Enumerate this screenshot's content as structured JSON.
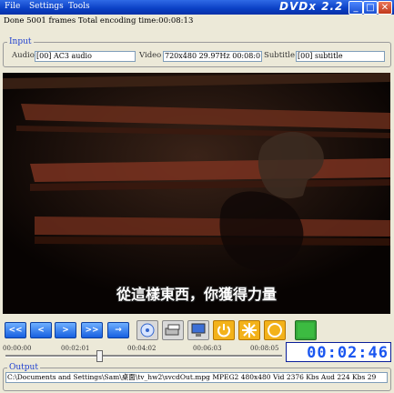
{
  "menu": [
    "File",
    "Settings",
    "Tools"
  ],
  "app_title": "DVDx 2.2",
  "window_buttons": {
    "minimize": "_",
    "maximize": "□",
    "close": "✕"
  },
  "status": {
    "frames": "Done 5001 frames",
    "encoding_time": "Total encoding time:00:08:13"
  },
  "input": {
    "title": "Input",
    "audio_label": "Audio",
    "audio_value": "[00] AC3 audio",
    "video_label": "Video",
    "video_value": "720x480 29.97Hz 00:08:0",
    "subtitle_label": "Subtitle",
    "subtitle_value": "[00] subtitle"
  },
  "video": {
    "subtitle_text": "從這樣東西，你獲得力量"
  },
  "nav_buttons": [
    "<<",
    "<",
    ">",
    ">>",
    "→"
  ],
  "icons": [
    "disc-icon",
    "convert-icon",
    "monitor-icon",
    "power-icon",
    "sun-icon",
    "circle-icon",
    "green-square-icon"
  ],
  "timeline": {
    "ticks": [
      "00:00:00",
      "00:02:01",
      "00:04:02",
      "00:06:03",
      "00:08:05"
    ],
    "position": 0.34,
    "timecode": "00:02:46 01"
  },
  "output": {
    "title": "Output",
    "value": "C:\\Documents and Settings\\Sam\\桌面\\tv_hw2\\svcdOut.mpg MPEG2 480x480 Vid 2376 Kbs Aud 224 Kbs 29"
  }
}
